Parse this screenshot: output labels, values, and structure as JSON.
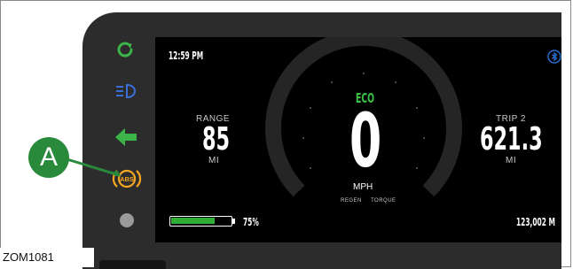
{
  "display": {
    "time": "12:59 PM",
    "mode": "ECO",
    "speed": "0",
    "speed_unit": "MPH",
    "gauge_left_label": "REGEN",
    "gauge_right_label": "TORQUE",
    "range": {
      "label": "RANGE",
      "value": "85",
      "unit": "MI"
    },
    "trip": {
      "label": "TRIP 2",
      "value": "621.3",
      "unit": "MI"
    },
    "battery": {
      "percent_text": "75%",
      "level": 0.75
    },
    "odometer": "123,002 M"
  },
  "indicators": [
    {
      "name": "charging-icon",
      "color": "#3bb54a"
    },
    {
      "name": "headlight-icon",
      "color": "#3a6fd8"
    },
    {
      "name": "turn-signal-left-icon",
      "color": "#3bb54a"
    },
    {
      "name": "abs-warning-icon",
      "color": "#f5a623",
      "text": "ABS"
    },
    {
      "name": "indicator-light-off",
      "color": "#9a9a9a"
    }
  ],
  "callout": {
    "letter": "A"
  },
  "figure_id": "ZOM1081",
  "colors": {
    "accent_green": "#2a8a3c",
    "eco_green": "#3bc44a",
    "abs_amber": "#f5a623",
    "bluetooth_blue": "#2b6fd8"
  }
}
